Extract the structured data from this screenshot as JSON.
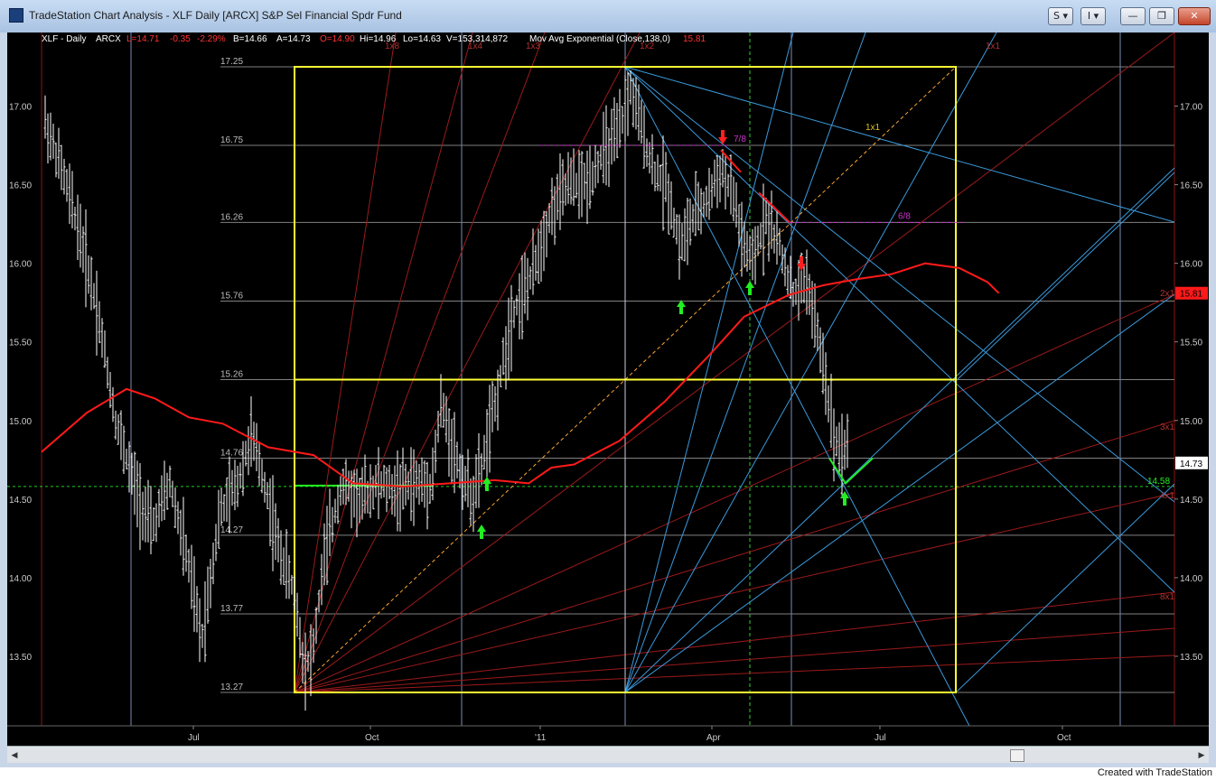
{
  "window": {
    "title": "TradeStation Chart Analysis - XLF Daily [ARCX] S&P Sel Financial Spdr Fund",
    "buttons": {
      "s_menu": "S ▾",
      "i_menu": "I ▾",
      "minimize": "—",
      "restore": "❐",
      "close": "✕"
    }
  },
  "footer": {
    "credit": "Created with TradeStation"
  },
  "header": {
    "symbol": "XLF - Daily",
    "exchange": "ARCX",
    "last": "L=14.71",
    "change": "-0.35",
    "pct": "-2.29%",
    "bid": "B=14.66",
    "ask": "A=14.73",
    "open": "O=14.90",
    "high": "Hi=14.96",
    "low": "Lo=14.63",
    "volume": "V=153,314,872",
    "indicator": "Mov Avg Exponential (Close,138,0)",
    "indicator_value": "15.81"
  },
  "colors": {
    "background": "#000000",
    "bars": "#ffffff",
    "ema": "#ff1a1a",
    "box": "#ffff33",
    "gann_fan_red": "#9b1a1a",
    "gann_fan_blue": "#3a9adc",
    "grid": "#808080",
    "vertical_marker": "#b0c8ff",
    "up_arrow": "#22ee22",
    "down_arrow": "#ff2020",
    "octave_label": "#cc33cc",
    "last_price_bg": "#ffffff",
    "ema_price_bg": "#ff1a1a",
    "support_line": "#22ee22"
  },
  "chart_data": {
    "type": "ohlc",
    "x_ticks": [
      "Jul",
      "Oct",
      "'11",
      "Apr",
      "Jul",
      "Oct"
    ],
    "y_ticks": [
      "17.00",
      "16.50",
      "16.00",
      "15.50",
      "15.00",
      "14.50",
      "14.00",
      "13.50"
    ],
    "y_range": [
      13.2,
      17.5
    ],
    "levels": [
      {
        "label": "17.25",
        "value": 17.25
      },
      {
        "label": "16.75",
        "value": 16.75
      },
      {
        "label": "16.26",
        "value": 16.26
      },
      {
        "label": "15.76",
        "value": 15.76
      },
      {
        "label": "15.26",
        "value": 15.26
      },
      {
        "label": "14.76",
        "value": 14.76
      },
      {
        "label": "14.27",
        "value": 14.27
      },
      {
        "label": "13.77",
        "value": 13.77
      },
      {
        "label": "13.27",
        "value": 13.27
      }
    ],
    "last_price_label": "14.73",
    "ema_price_label": "15.81",
    "support_value_label": "14.58",
    "octave_labels": [
      "7/8",
      "6/8"
    ],
    "gann_labels": [
      "1x8",
      "1x4",
      "1x3",
      "1x2",
      "1x1",
      "1x1",
      "2x1",
      "3x1",
      "4x1",
      "8x1"
    ],
    "ema_series": [
      [
        0.0,
        14.8
      ],
      [
        0.04,
        15.05
      ],
      [
        0.075,
        15.2
      ],
      [
        0.1,
        15.14
      ],
      [
        0.13,
        15.02
      ],
      [
        0.16,
        14.98
      ],
      [
        0.2,
        14.83
      ],
      [
        0.24,
        14.78
      ],
      [
        0.275,
        14.6
      ],
      [
        0.32,
        14.58
      ],
      [
        0.36,
        14.6
      ],
      [
        0.4,
        14.62
      ],
      [
        0.43,
        14.6
      ],
      [
        0.45,
        14.7
      ],
      [
        0.47,
        14.72
      ],
      [
        0.51,
        14.87
      ],
      [
        0.55,
        15.12
      ],
      [
        0.59,
        15.42
      ],
      [
        0.62,
        15.66
      ],
      [
        0.66,
        15.8
      ],
      [
        0.69,
        15.86
      ],
      [
        0.72,
        15.9
      ],
      [
        0.75,
        15.93
      ],
      [
        0.78,
        16.0
      ],
      [
        0.81,
        15.97
      ],
      [
        0.835,
        15.88
      ],
      [
        0.845,
        15.81
      ]
    ]
  }
}
